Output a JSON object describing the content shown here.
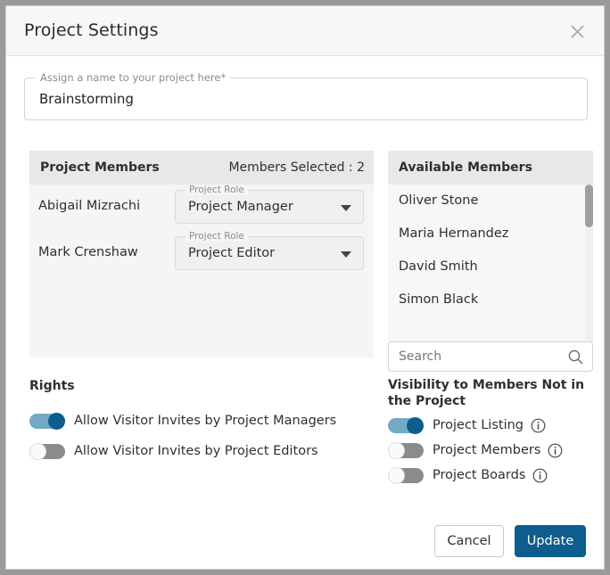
{
  "dialog": {
    "title": "Project Settings",
    "close_icon": "close-icon"
  },
  "project_name": {
    "label": "Assign a name to your project here*",
    "value": "Brainstorming",
    "placeholder": ""
  },
  "project_members": {
    "title": "Project Members",
    "count_label": "Members Selected : 2",
    "role_legend": "Project Role",
    "members": [
      {
        "name": "Abigail Mizrachi",
        "role": "Project Manager"
      },
      {
        "name": "Mark Crenshaw",
        "role": "Project Editor"
      }
    ]
  },
  "available_members": {
    "title": "Available Members",
    "items": [
      {
        "name": "Oliver Stone"
      },
      {
        "name": "Maria Hernandez"
      },
      {
        "name": "David Smith"
      },
      {
        "name": "Simon Black"
      }
    ]
  },
  "search": {
    "placeholder": "Search",
    "value": "",
    "icon": "search-icon"
  },
  "rights": {
    "title": "Rights",
    "items": [
      {
        "label": "Allow Visitor Invites by Project Managers",
        "state": "on"
      },
      {
        "label": "Allow Visitor Invites by Project Editors",
        "state": "off"
      }
    ]
  },
  "visibility": {
    "title": "Visibility to Members Not in the Project",
    "items": [
      {
        "label": "Project Listing",
        "state": "on",
        "info_icon": "info-icon"
      },
      {
        "label": "Project Members",
        "state": "off",
        "info_icon": "info-icon"
      },
      {
        "label": "Project Boards",
        "state": "off",
        "info_icon": "info-icon"
      }
    ]
  },
  "footer": {
    "cancel_label": "Cancel",
    "update_label": "Update"
  },
  "colors": {
    "accent": "#0d5d8e",
    "toggle_on_track": "#74a9c6",
    "toggle_off_track": "#8b8b8b",
    "panel_header": "#e8e8e8",
    "panel_body": "#f5f5f5"
  }
}
